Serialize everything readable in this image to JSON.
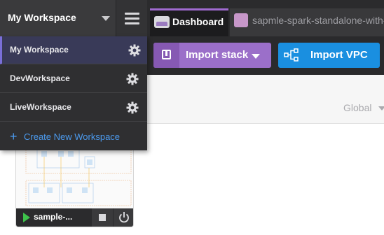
{
  "workspace_header": {
    "title": "My Workspace"
  },
  "tabs": [
    {
      "label": "Dashboard",
      "active": true
    },
    {
      "label": "sapmle-spark-standalone-with-",
      "active": false
    }
  ],
  "toolbar": {
    "import_stack_label": "Import stack",
    "import_vpc_label": "Import VPC"
  },
  "region": {
    "label": "Global"
  },
  "workspace_menu": {
    "items": [
      {
        "label": "My Workspace",
        "active": true
      },
      {
        "label": "DevWorkspace",
        "active": false
      },
      {
        "label": "LiveWorkspace",
        "active": false
      }
    ],
    "create_label": "Create New Workspace"
  },
  "stack_card": {
    "name": "sample-..."
  },
  "colors": {
    "accent_purple": "#9b6fc9",
    "accent_blue": "#1a8fe0",
    "link_blue": "#4c9bef",
    "run_green": "#3ec24b"
  }
}
